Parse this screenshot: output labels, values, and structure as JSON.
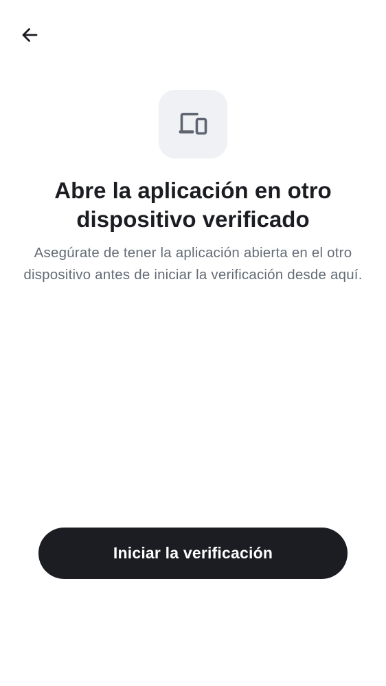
{
  "header": {
    "back_icon": "arrow-left-icon"
  },
  "hero": {
    "icon": "devices-icon",
    "icon_color": "#5e6570",
    "icon_background": "#eff1f5"
  },
  "content": {
    "title": "Abre la aplicación en otro dispositivo verificado",
    "subtitle": "Asegúrate de tener la aplicación abierta en el otro dispositivo antes de iniciar la verificación desde aquí."
  },
  "actions": {
    "start_label": "Iniciar la verificación"
  },
  "colors": {
    "primary": "#1b1d22",
    "text_secondary": "#656c76",
    "background": "#ffffff"
  }
}
